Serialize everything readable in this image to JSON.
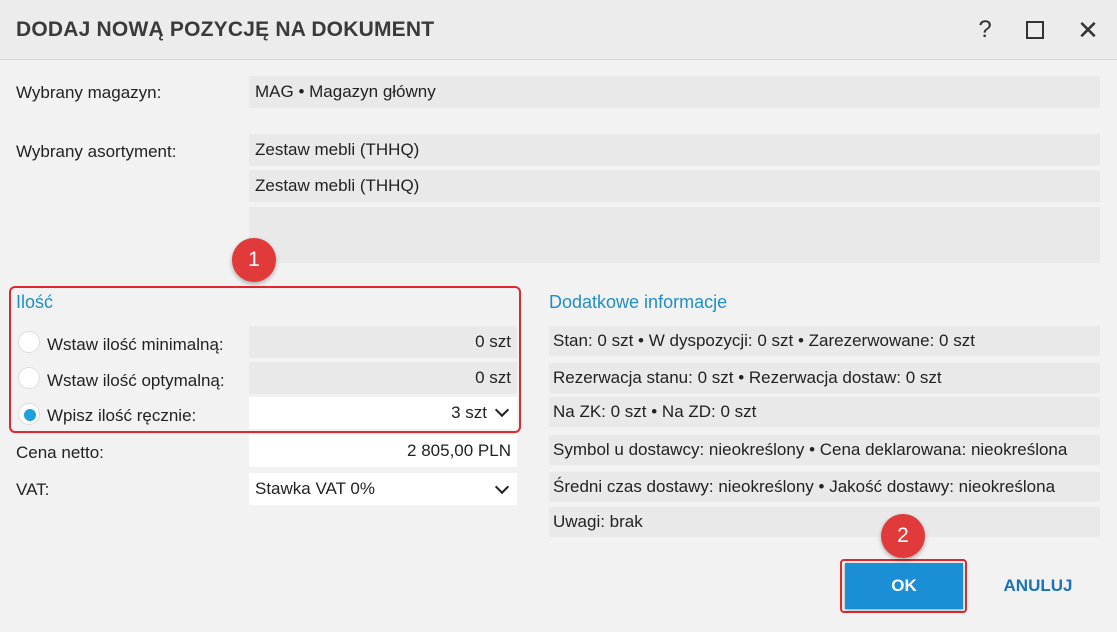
{
  "dialog": {
    "title": "DODAJ NOWĄ POZYCJĘ NA DOKUMENT",
    "help_glyph": "?",
    "close_glyph": "✕"
  },
  "warehouse": {
    "label": "Wybrany magazyn:",
    "value": "MAG • Magazyn główny"
  },
  "assortment": {
    "label": "Wybrany asortyment:",
    "name": "Zestaw mebli (THHQ)",
    "name2": "Zestaw mebli (THHQ)",
    "description": ""
  },
  "quantity": {
    "section_title": "Ilość",
    "min_label": "Wstaw ilość minimalną:",
    "min_value": "0 szt",
    "min_selected": false,
    "opt_label": "Wstaw ilość optymalną:",
    "opt_value": "0 szt",
    "opt_selected": false,
    "manual_label": "Wpisz ilość ręcznie:",
    "manual_value": "3 szt",
    "manual_selected": true
  },
  "price": {
    "label": "Cena netto:",
    "value": "2 805,00 PLN"
  },
  "vat": {
    "label": "VAT:",
    "value": "Stawka VAT 0%"
  },
  "additional_info": {
    "title": "Dodatkowe informacje",
    "rows": [
      "Stan: 0 szt  •  W dyspozycji: 0 szt  •  Zarezerwowane: 0 szt",
      "Rezerwacja stanu: 0 szt  •  Rezerwacja dostaw: 0 szt",
      "Na ZK: 0 szt  •  Na ZD: 0 szt",
      "Symbol u dostawcy: nieokreślony  •  Cena deklarowana: nieokreślona",
      "Średni czas dostawy: nieokreślony  •  Jakość dostawy: nieokreślona",
      "Uwagi: brak"
    ]
  },
  "annotations": {
    "marker1": "1",
    "marker2": "2",
    "color": "#e03a3a"
  },
  "buttons": {
    "ok": "OK",
    "cancel": "ANULUJ",
    "ok_color": "#1b8fd6"
  }
}
